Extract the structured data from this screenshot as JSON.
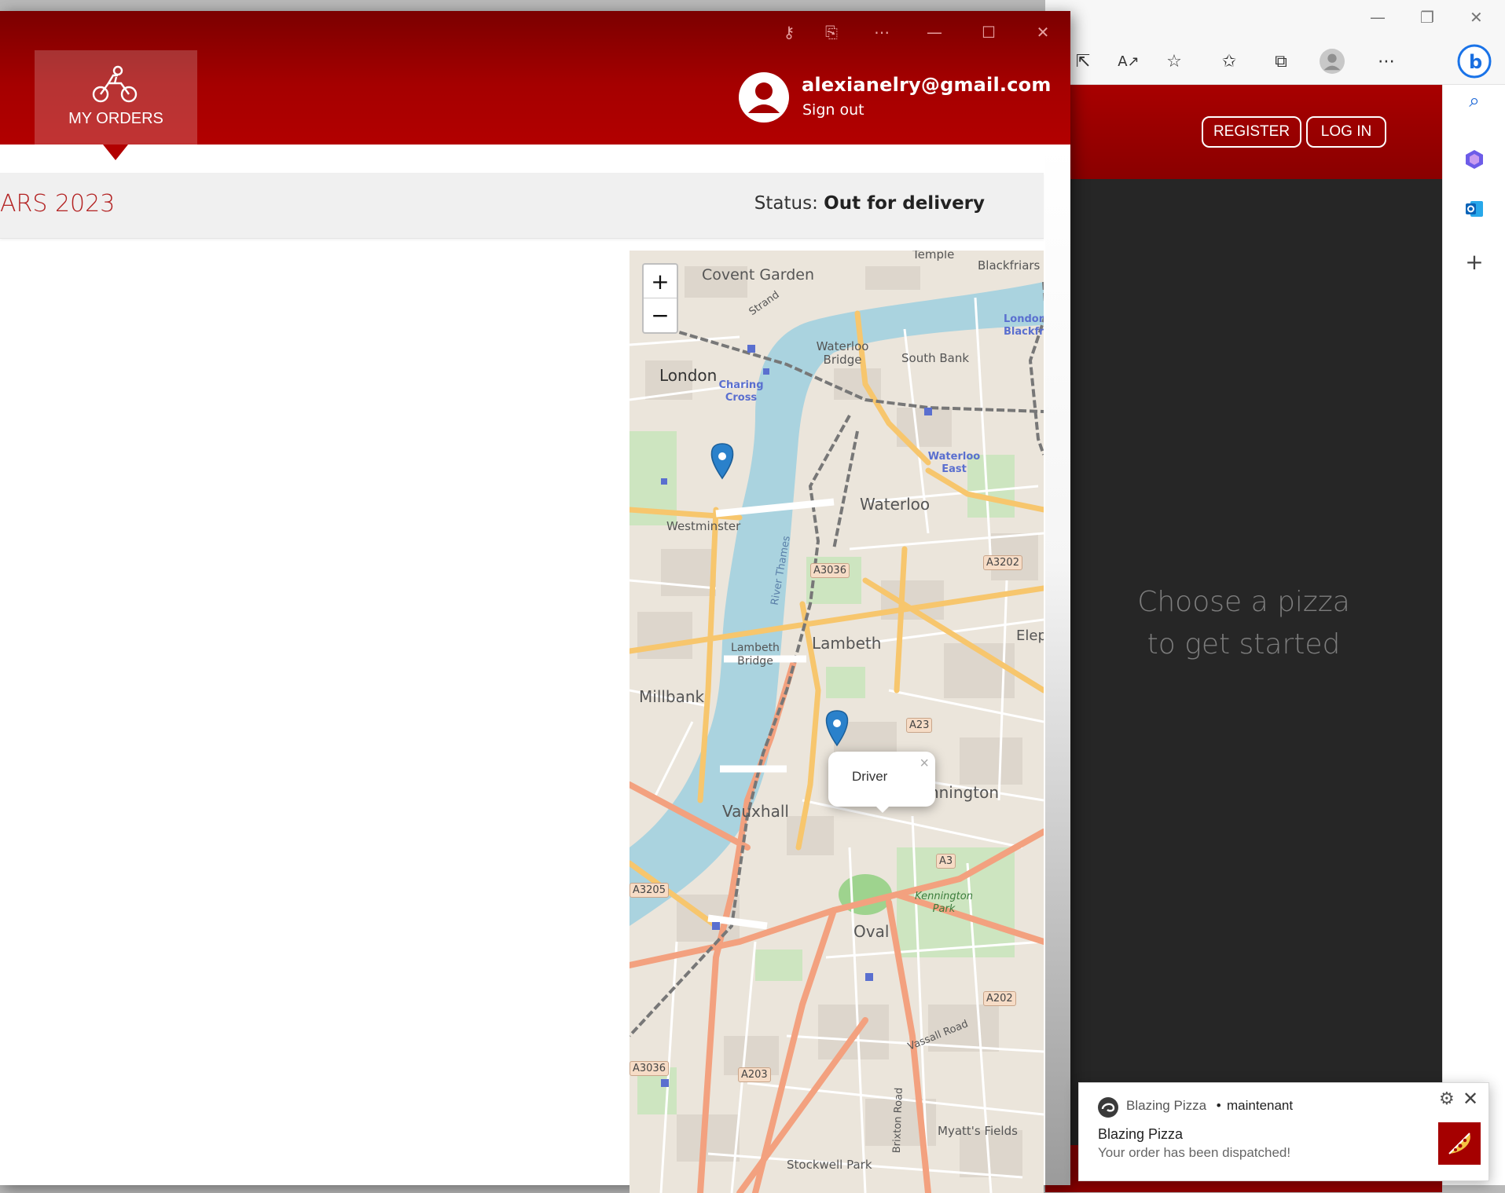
{
  "app": {
    "nav": {
      "my_orders_label": "MY ORDERS"
    },
    "user": {
      "email": "alexianelry@gmail.com",
      "sign_out": "Sign out"
    },
    "order": {
      "title": "ARS 2023",
      "status_label": "Status:",
      "status_value": "Out for delivery"
    },
    "titlebar_icons": [
      "key-icon",
      "cast-icon",
      "more-icon",
      "minimize-icon",
      "maximize-icon",
      "close-icon"
    ],
    "colors": {
      "header_top": "#7b0000",
      "header_bottom": "#b20000",
      "title_red": "#b32121"
    }
  },
  "map": {
    "zoom_in": "+",
    "zoom_out": "−",
    "popup_text": "Driver",
    "popup_close": "×",
    "labels": [
      "Covent Garden",
      "Blackfriars",
      "Temple",
      "Strand",
      "Waterloo Bridge",
      "South Bank",
      "London",
      "Charing Cross",
      "Waterloo East",
      "Waterloo",
      "Westminster",
      "River Thames",
      "Lambeth",
      "Lambeth Bridge",
      "Millbank",
      "Vauxhall",
      "Kennington Park",
      "Oval",
      "Kennington",
      "Vassall Road",
      "Brixton Road",
      "Myatt's Fields",
      "Stockwell Park",
      "Elephant",
      "London Blackfriars"
    ],
    "roads": [
      "A3036",
      "A3202",
      "A23",
      "A3",
      "A3205",
      "A202",
      "A203",
      "A3036"
    ],
    "markers": [
      "Westminster marker",
      "Driver marker"
    ]
  },
  "background_browser": {
    "register": "REGISTER",
    "login": "LOG IN",
    "empty_line1": "Choose a pizza",
    "empty_line2": "to get started"
  },
  "notification": {
    "source": "Blazing Pizza",
    "separator": "•",
    "time": "maintenant",
    "title": "Blazing Pizza",
    "body": "Your order has been dispatched!"
  }
}
